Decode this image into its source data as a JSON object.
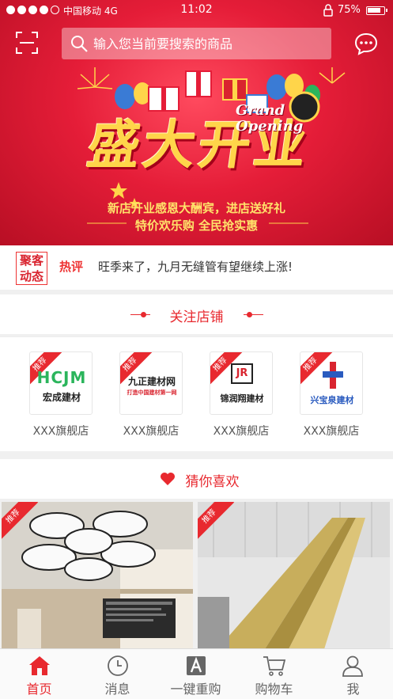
{
  "status_bar": {
    "carrier": "中国移动 4G",
    "time": "11:02",
    "battery": "75%"
  },
  "search": {
    "placeholder": "输入您当前要搜索的商品"
  },
  "banner": {
    "title": "盛大开业",
    "english_line1": "Grand",
    "english_line2": "Opening",
    "subtitle1": "新店开业感恩大酬宾，进店送好礼",
    "subtitle2": "特价欢乐购    全民抢实惠"
  },
  "news": {
    "logo_line1": "聚客",
    "logo_line2": "动态",
    "tag": "热评",
    "text": "旺季来了，九月无缝管有望继续上涨!"
  },
  "stores_section": {
    "title": "关注店铺",
    "badge": "推荐",
    "items": [
      {
        "brand_line1": "HCJM",
        "brand_line2": "宏成建材",
        "name": "XXX旗舰店"
      },
      {
        "brand_line1": "九正建材网",
        "brand_line2": "打造中国建材第一网",
        "name": "XXX旗舰店"
      },
      {
        "brand_line1": "JR",
        "brand_line2": "锦润翔建材",
        "name": "XXX旗舰店"
      },
      {
        "brand_line1": "兴宝泉建材",
        "brand_line2": "",
        "name": "XXX旗舰店"
      }
    ]
  },
  "recommend_section": {
    "title": "猜你喜欢",
    "badge": "推荐"
  },
  "tabs": [
    {
      "label": "首页",
      "icon": "home-icon",
      "active": true
    },
    {
      "label": "消息",
      "icon": "clock-icon",
      "active": false
    },
    {
      "label": "一键重购",
      "icon": "reorder-icon",
      "active": false
    },
    {
      "label": "购物车",
      "icon": "cart-icon",
      "active": false
    },
    {
      "label": "我",
      "icon": "user-icon",
      "active": false
    }
  ],
  "colors": {
    "accent": "#e8292f",
    "banner": "#e51d38"
  }
}
